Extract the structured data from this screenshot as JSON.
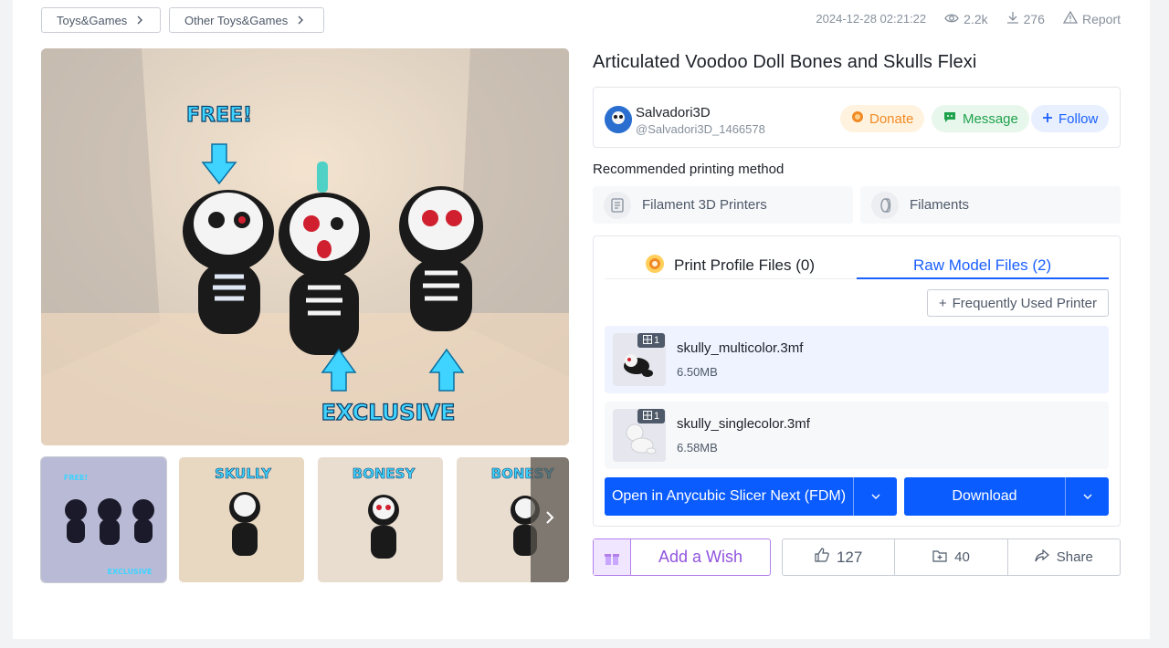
{
  "breadcrumb": [
    {
      "label": "Toys&Games"
    },
    {
      "label": "Other Toys&Games"
    }
  ],
  "meta": {
    "timestamp": "2024-12-28 02:21:22",
    "views": "2.2k",
    "downloads": "276",
    "report_label": "Report"
  },
  "hero": {
    "caption_top": "FREE!",
    "caption_bottom": "EXCLUSIVE"
  },
  "thumbnails": [
    {
      "caption": "FREE!",
      "caption2": "EXCLUSIVE"
    },
    {
      "caption": "SKULLY"
    },
    {
      "caption": "BONESY"
    },
    {
      "caption": "BONESY"
    }
  ],
  "title": "Articulated Voodoo Doll Bones and Skulls Flexi",
  "author": {
    "name": "Salvadori3D",
    "handle": "@Salvadori3D_1466578",
    "donate_label": "Donate",
    "message_label": "Message",
    "follow_label": "Follow"
  },
  "printing": {
    "label": "Recommended printing method",
    "methods": [
      {
        "label": "Filament 3D Printers",
        "icon": "printer-icon"
      },
      {
        "label": "Filaments",
        "icon": "filament-spool-icon"
      }
    ]
  },
  "files": {
    "tabs": [
      {
        "label": "Print Profile Files (0)"
      },
      {
        "label": "Raw Model Files (2)"
      }
    ],
    "frequent_printer_label": "Frequently Used Printer",
    "items": [
      {
        "name": "skully_multicolor.3mf",
        "size": "6.50MB",
        "plates": "1"
      },
      {
        "name": "skully_singlecolor.3mf",
        "size": "6.58MB",
        "plates": "1"
      }
    ],
    "open_label": "Open in Anycubic Slicer Next (FDM)",
    "download_label": "Download"
  },
  "actions": {
    "wish_label": "Add a Wish",
    "likes": "127",
    "collects": "40",
    "share_label": "Share"
  },
  "colors": {
    "accent_blue": "#0a5cff",
    "wish_purple": "#9254de",
    "donate_orange": "#f08a24",
    "message_green": "#1fa24c"
  }
}
